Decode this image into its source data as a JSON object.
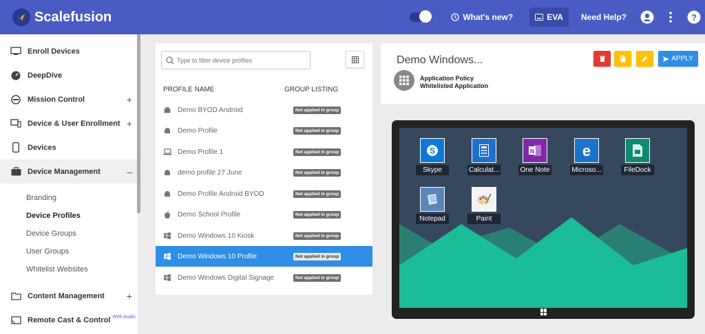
{
  "header": {
    "app_name": "Scalefusion",
    "whats_new": "What's new?",
    "eva": "EVA",
    "need_help": "Need Help?"
  },
  "sidebar": {
    "items": [
      {
        "label": "Enroll Devices",
        "icon": "enroll-icon"
      },
      {
        "label": "DeepDive",
        "icon": "gauge-icon"
      },
      {
        "label": "Mission Control",
        "icon": "mission-icon",
        "expand": "+"
      },
      {
        "label": "Device & User Enrollment",
        "icon": "devices-icon",
        "expand": "+"
      },
      {
        "label": "Devices",
        "icon": "phone-icon"
      },
      {
        "label": "Device Management",
        "icon": "briefcase-icon",
        "expand": "–"
      }
    ],
    "sub_items": [
      "Branding",
      "Device Profiles",
      "Device Groups",
      "User Groups",
      "Whitelist Websites"
    ],
    "bottom_items": [
      {
        "label": "Content Management",
        "icon": "folder-icon",
        "expand": "+"
      },
      {
        "label": "Remote Cast & Control",
        "icon": "cast-icon",
        "tag": "With Audio"
      }
    ]
  },
  "profiles": {
    "search_placeholder": "Type to filter device profiles",
    "col_name": "PROFILE NAME",
    "col_group": "GROUP LISTING",
    "rows": [
      {
        "name": "Demo BYOD Android",
        "icon": "android",
        "group": "Not applied in group"
      },
      {
        "name": "Demo Profile",
        "icon": "android",
        "group": "Not applied in group"
      },
      {
        "name": "Demo Profile 1",
        "icon": "laptop",
        "group": "Not applied in group"
      },
      {
        "name": "demo profile 27 June",
        "icon": "android",
        "group": "Not applied in group"
      },
      {
        "name": "Demo Profile Android BYOD",
        "icon": "android",
        "group": "Not applied in group"
      },
      {
        "name": "Demo School Profile",
        "icon": "apple",
        "group": "Not applied in group"
      },
      {
        "name": "Demo Windows 10 Kiosk",
        "icon": "windows",
        "group": "Not applied in group"
      },
      {
        "name": "Demo Windows 10 Profile",
        "icon": "windows",
        "group": "Not applied in group",
        "selected": true
      },
      {
        "name": "Demo Windows Digital Signage",
        "icon": "windows",
        "group": "Not applied in group"
      }
    ]
  },
  "detail": {
    "title": "Demo Windows...",
    "line1": "Application Policy",
    "line2": "Whitelisted Application",
    "apply_label": "APPLY",
    "colors": {
      "delete": "#e53935",
      "copy": "#ffc107",
      "edit": "#ffc107",
      "apply": "#2f8ee6"
    }
  },
  "preview": {
    "apps": [
      {
        "label": "Skype",
        "icon": "skype-icon",
        "color": "#0b78d7"
      },
      {
        "label": "Calculat...",
        "icon": "calculator-icon",
        "color": "#1f6fd1"
      },
      {
        "label": "One Note",
        "icon": "onenote-icon",
        "color": "#7e2aa8"
      },
      {
        "label": "Microso...",
        "icon": "edge-icon",
        "color": "#1a73c8"
      },
      {
        "label": "FileDock",
        "icon": "filedock-icon",
        "color": "#0f8a6c"
      },
      {
        "label": "Notepad",
        "icon": "notepad-icon",
        "color": "#5a86b8"
      },
      {
        "label": "Paint",
        "icon": "paint-icon",
        "color": "#ffffff"
      }
    ]
  }
}
